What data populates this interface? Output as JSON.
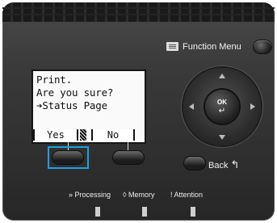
{
  "display": {
    "line1": "Print.",
    "line2": "Are you sure?",
    "line3": "➔Status Page",
    "softkey_left": "Yes",
    "softkey_right": "No"
  },
  "controls": {
    "function_menu_label": "Function Menu",
    "ok_label": "OK",
    "ok_symbol": "↵",
    "back_label": "Back",
    "back_symbol": "↰"
  },
  "indicators": {
    "processing_icon": "»",
    "processing_label": "Processing",
    "memory_icon": "◊",
    "memory_label": "Memory",
    "attention_icon": "!",
    "attention_label": "Attention"
  },
  "colors": {
    "selection_highlight": "#1fa0e0"
  }
}
